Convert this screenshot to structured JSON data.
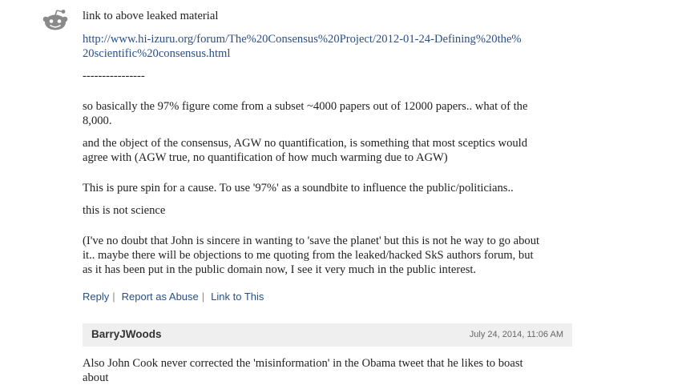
{
  "comment": {
    "avatar_icon": "reddit-alien-icon",
    "lines": {
      "l1": "link to above leaked material",
      "url1": "http://www.hi-izuru.org/forum/The%20Consensus%20Project/2012-01-24-Defining%20the%",
      "url2": "20scientific%20consensus.html",
      "dashes": "----------------",
      "p1a": "so basically the 97% figure come from a subset ~4000 papers out of 12000 papers.. what of the",
      "p1b": "8,000.",
      "p2a": "and the object of the consensus, AGW no quantification, is something that most sceptics would",
      "p2b": "agree with (AGW true, no quantification of how much warming due to AGW)",
      "p3": "This is pure spin for a cause. To use '97%' as a soundbite to influence the public/politicians..",
      "p4": "this is not science",
      "p5a": "(I've no doubt that John is sincere in wanting to 'save the planet' but this is not he way to go about",
      "p5b": "it.. maybe there will be objections to me quoting from the leaked/hacked SkS authors forum, but",
      "p5c": "as it has been put in the public domain now, I see it very much in the public interest."
    },
    "actions": {
      "reply": "Reply",
      "report": "Report as Abuse",
      "link": "Link to This",
      "separator": "|"
    }
  },
  "reply": {
    "author": "BarryJWoods",
    "date": "July 24, 2014, 11:06 AM",
    "lines": {
      "a": "Also John Cook never corrected the 'misinformation' in the Obama tweet that he likes to boast",
      "b": "about"
    }
  },
  "colors": {
    "link": "#2a4f84",
    "header_bg": "#efefef",
    "text": "#222222"
  }
}
